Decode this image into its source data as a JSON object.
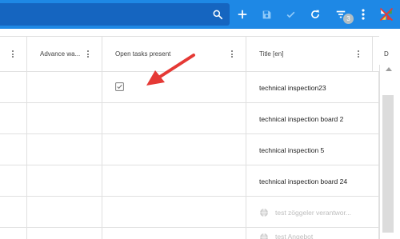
{
  "toolbar": {
    "filter_badge_count": "3",
    "icons": [
      "search-icon",
      "add-icon",
      "save-icon",
      "check-icon",
      "refresh-icon",
      "filter-icon",
      "more-vert-icon",
      "app-logo-icon"
    ]
  },
  "grid": {
    "columns": [
      {
        "label": "",
        "has_menu": true
      },
      {
        "label": "Advance wa...",
        "has_menu": true
      },
      {
        "label": "Open tasks present",
        "has_menu": true
      },
      {
        "label": "Title [en]",
        "has_menu": true
      },
      {
        "label": "D",
        "has_menu": false
      }
    ],
    "rows": [
      {
        "open_tasks_checked": true,
        "title": "technical inspection23",
        "muted": false
      },
      {
        "open_tasks_checked": false,
        "title": "technical inspection board 2",
        "muted": false
      },
      {
        "open_tasks_checked": false,
        "title": "technical inspection 5",
        "muted": false
      },
      {
        "open_tasks_checked": false,
        "title": "technical inspection board 24",
        "muted": false
      },
      {
        "open_tasks_checked": false,
        "title": "test zöggeler verantwor...",
        "muted": true
      },
      {
        "open_tasks_checked": false,
        "title": "test Angebot",
        "muted": true
      }
    ]
  },
  "colors": {
    "toolbar_bg": "#1e88e5",
    "search_bg": "#1565c0",
    "annotation_arrow": "#e53935"
  }
}
